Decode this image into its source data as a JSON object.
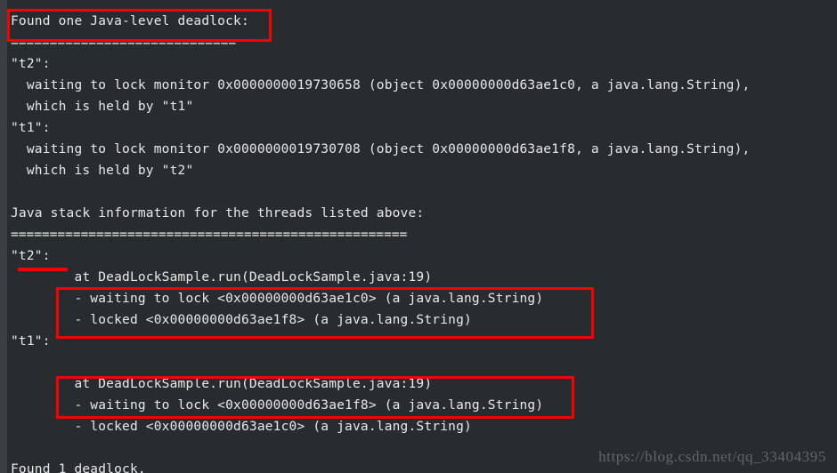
{
  "terminal": {
    "background_color": "#292c2f",
    "gutter_color": "#3b3e42",
    "text_color": "#e8e9ea",
    "annotation_color": "#f60000",
    "lines": [
      {
        "id": "header",
        "text": "Found one Java-level deadlock:"
      },
      {
        "id": "sep-top",
        "text": "============================="
      },
      {
        "id": "t2-header",
        "text": "\"t2\":"
      },
      {
        "id": "t2-waiting",
        "text": "  waiting to lock monitor 0x0000000019730658 (object 0x00000000d63ae1c0, a java.lang.String),"
      },
      {
        "id": "t2-held",
        "text": "  which is held by \"t1\""
      },
      {
        "id": "t1-header",
        "text": "\"t1\":"
      },
      {
        "id": "t1-waiting",
        "text": "  waiting to lock monitor 0x0000000019730708 (object 0x00000000d63ae1f8, a java.lang.String),"
      },
      {
        "id": "t1-held",
        "text": "  which is held by \"t2\""
      },
      {
        "id": "blank-1",
        "text": ""
      },
      {
        "id": "stack-title",
        "text": "Java stack information for the threads listed above:"
      },
      {
        "id": "sep-mid",
        "text": "==================================================="
      },
      {
        "id": "stack-t2",
        "text": "\"t2\":"
      },
      {
        "id": "stack-t2-at",
        "text": "        at DeadLockSample.run(DeadLockSample.java:19)"
      },
      {
        "id": "stack-t2-wait",
        "text": "        - waiting to lock <0x00000000d63ae1c0> (a java.lang.String)"
      },
      {
        "id": "stack-t2-lock",
        "text": "        - locked <0x00000000d63ae1f8> (a java.lang.String)"
      },
      {
        "id": "stack-t1",
        "text": "\"t1\":"
      },
      {
        "id": "blank-2",
        "text": ""
      },
      {
        "id": "stack-t1-at",
        "text": "        at DeadLockSample.run(DeadLockSample.java:19)"
      },
      {
        "id": "stack-t1-wait",
        "text": "        - waiting to lock <0x00000000d63ae1f8> (a java.lang.String)"
      },
      {
        "id": "stack-t1-lock",
        "text": "        - locked <0x00000000d63ae1c0> (a java.lang.String)"
      },
      {
        "id": "blank-3",
        "text": ""
      },
      {
        "id": "footer",
        "text": "Found 1 deadlock."
      }
    ]
  },
  "annotations": {
    "header_box_label": "highlight-found-one-deadlock",
    "t2_underline_label": "underline-thread-t2",
    "t2_stack_box_label": "highlight-t2-lock-pair",
    "t1_stack_box_label": "highlight-t1-lock-pair"
  },
  "watermark": {
    "text": "https://blog.csdn.net/qq_33404395"
  }
}
